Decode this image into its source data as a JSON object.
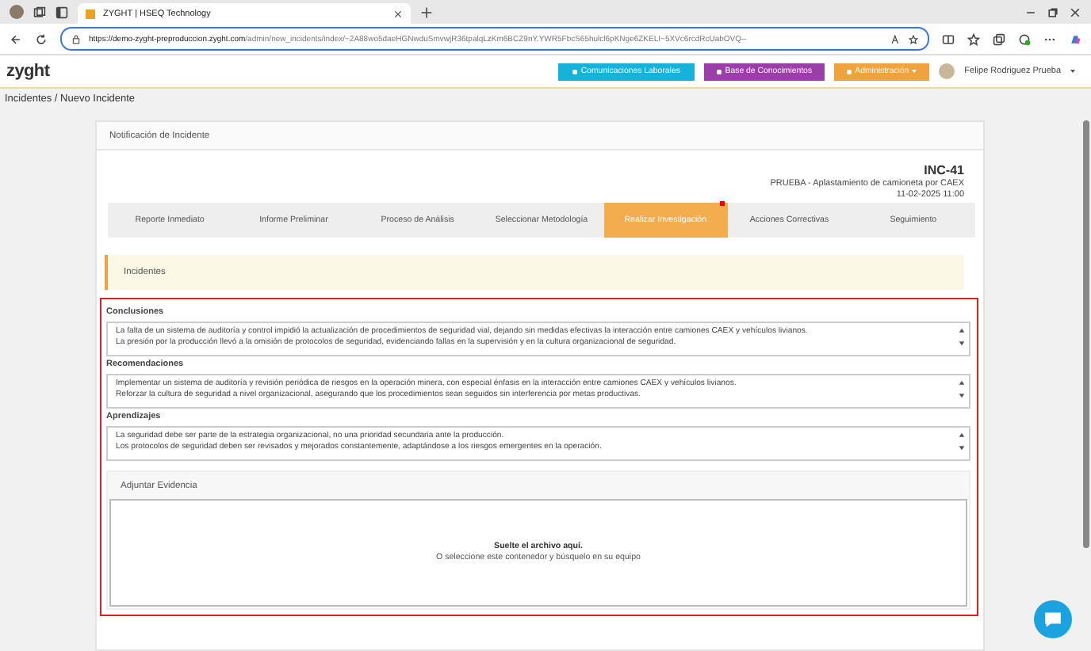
{
  "browser": {
    "tab_title": "ZYGHT | HSEQ Technology",
    "url_host": "https://demo-zyght-preproduccion.zyght.com",
    "url_path": "/admin/new_incidents/index/~2A88wo5daeHGNwduSmvwjR36tpalqLzKm6BCZ9nY.YWR5FbcS65hulcl6pKNge6ZKELI~5XVc6rcdRcUabOVQ--"
  },
  "header": {
    "logo": "zyght",
    "buttons": [
      {
        "label": "Comunicaciones Laborales",
        "kind": "info"
      },
      {
        "label": "Base de Conocimientos",
        "kind": "purple"
      },
      {
        "label": "Administración",
        "kind": "warning"
      }
    ],
    "user": "Felipe Rodriguez Prueba"
  },
  "breadcrumb": "Incidentes / Nuevo Incidente",
  "card": {
    "title": "Notificación de Incidente",
    "code": "INC-41",
    "subtitle": "PRUEBA - Aplastamiento de camioneta por CAEX",
    "date": "11-02-2025 11:00",
    "steps": [
      {
        "label": "Reporte Inmediato",
        "selected": false,
        "notification": false
      },
      {
        "label": "Informe Preliminar",
        "selected": false,
        "notification": false
      },
      {
        "label": "Proceso de Análisis",
        "selected": false,
        "notification": false
      },
      {
        "label": "Seleccionar Metodología",
        "selected": false,
        "notification": false
      },
      {
        "label": "Realizar Investigación",
        "selected": true,
        "notification": true
      },
      {
        "label": "Acciones Correctivas",
        "selected": false,
        "notification": false
      },
      {
        "label": "Seguimiento",
        "selected": false,
        "notification": false
      }
    ],
    "alert": "Incidentes",
    "fields": [
      {
        "label": "Conclusiones",
        "lines": [
          "La falta de un sistema de auditoría y control impidió la actualización de procedimientos de seguridad vial, dejando sin medidas efectivas la interacción entre camiones CAEX y vehículos livianos.",
          "La presión por la producción llevó a la omisión de protocolos de seguridad, evidenciando fallas en la supervisión y en la cultura organizacional de seguridad."
        ]
      },
      {
        "label": "Recomendaciones",
        "lines": [
          "Implementar un sistema de auditoría y revisión periódica de riesgos en la operación minera, con especial énfasis en la interacción entre camiones CAEX y vehículos livianos.",
          "Reforzar la cultura de seguridad a nivel organizacional, asegurando que los procedimientos sean seguidos sin interferencia por metas productivas."
        ]
      },
      {
        "label": "Aprendizajes",
        "lines": [
          "La seguridad debe ser parte de la estrategia organizacional, no una prioridad secundaria ante la producción.",
          "Los protocolos de seguridad deben ser revisados y mejorados constantemente, adaptándose a los riesgos emergentes en la operación."
        ]
      }
    ],
    "evidence": {
      "title": "Adjuntar Evidencia",
      "drop_title": "Suelte el archivo aquí.",
      "drop_hint": "O seleccione este contenedor y búsquelo en su equipo"
    }
  }
}
